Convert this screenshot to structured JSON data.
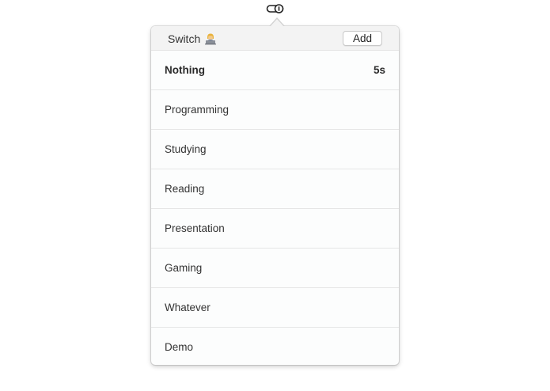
{
  "status_item": {
    "icon": "toggle-switch-icon"
  },
  "popover": {
    "header": {
      "title": "Switch",
      "title_icon": "person-at-laptop-icon",
      "add_label": "Add"
    },
    "activities": [
      {
        "label": "Nothing",
        "duration": "5s",
        "active": true
      },
      {
        "label": "Programming",
        "duration": "",
        "active": false
      },
      {
        "label": "Studying",
        "duration": "",
        "active": false
      },
      {
        "label": "Reading",
        "duration": "",
        "active": false
      },
      {
        "label": "Presentation",
        "duration": "",
        "active": false
      },
      {
        "label": "Gaming",
        "duration": "",
        "active": false
      },
      {
        "label": "Whatever",
        "duration": "",
        "active": false
      },
      {
        "label": "Demo",
        "duration": "",
        "active": false
      }
    ]
  }
}
